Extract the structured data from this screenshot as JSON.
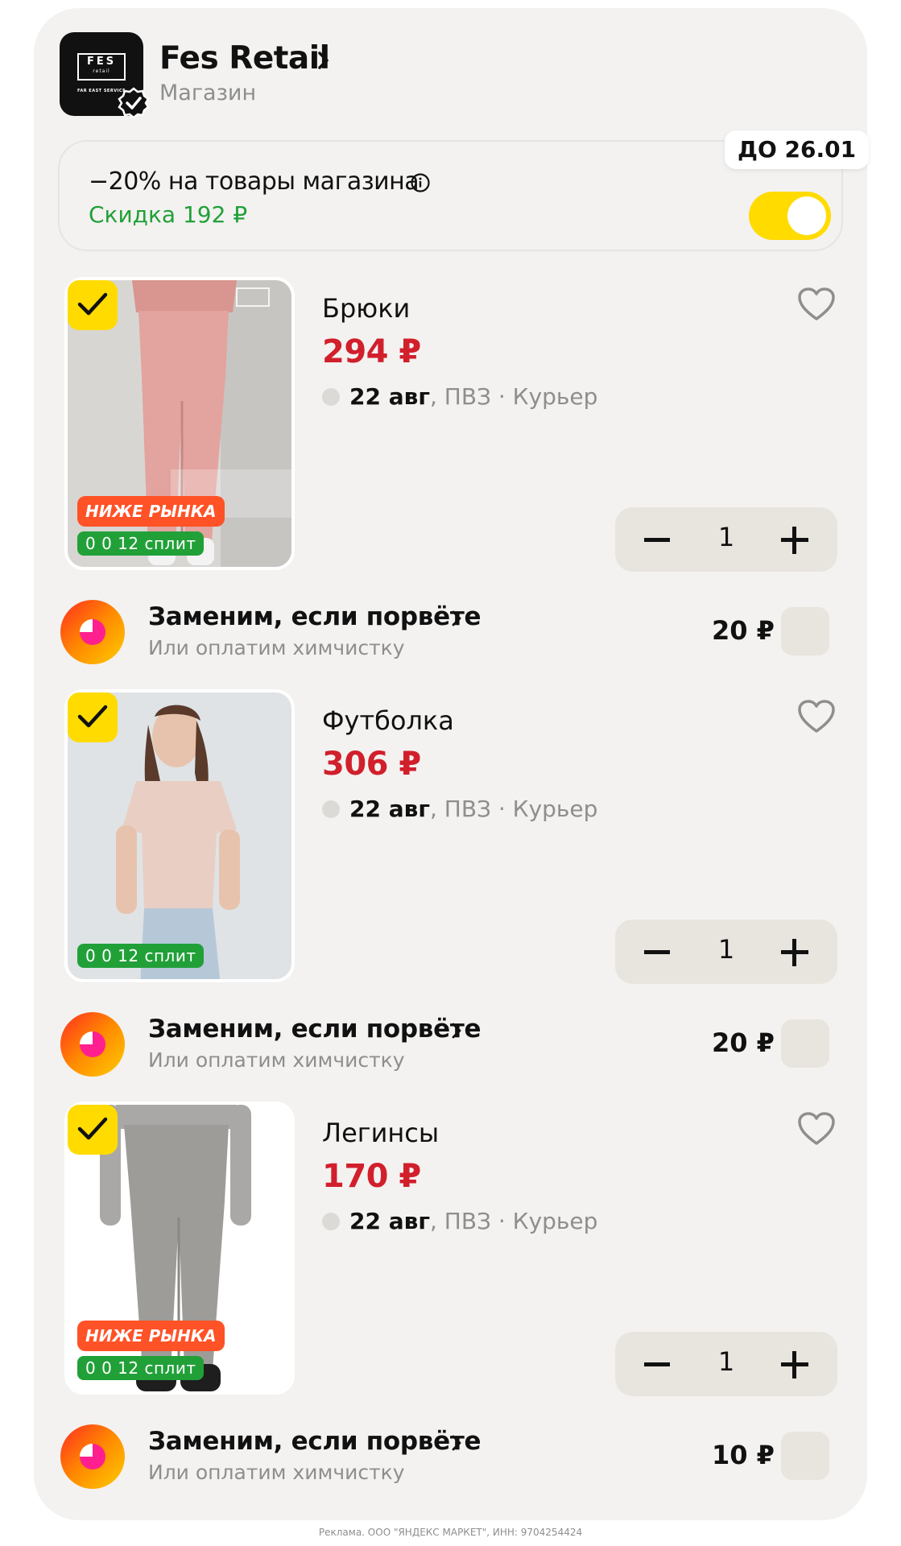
{
  "store": {
    "name": "Fes Retail",
    "type": "Магазин",
    "logo_text": "FES",
    "logo_small": "retail",
    "logo_sub": "FAR EAST SERVICE"
  },
  "promo": {
    "title": "−20% на товары магазина",
    "discount": "Скидка 192 ₽",
    "valid_until": "ДО 26.01",
    "enabled": true
  },
  "items": [
    {
      "title": "Брюки",
      "price": "294 ₽",
      "delivery_date": "22 авг",
      "delivery_methods": ", ПВЗ · Курьер",
      "badge_market": "НИЖЕ РЫНКА",
      "badge_split": "0 0 12 сплит",
      "quantity": "1",
      "selected": true,
      "insurance": {
        "title": "Заменим, если порвёте",
        "subtitle": "Или оплатим химчистку",
        "price": "20 ₽"
      }
    },
    {
      "title": "Футболка",
      "price": "306 ₽",
      "delivery_date": "22 авг",
      "delivery_methods": ", ПВЗ · Курьер",
      "badge_split": "0 0 12 сплит",
      "quantity": "1",
      "selected": true,
      "insurance": {
        "title": "Заменим, если порвёте",
        "subtitle": "Или оплатим химчистку",
        "price": "20 ₽"
      }
    },
    {
      "title": "Легинсы",
      "price": "170 ₽",
      "delivery_date": "22 авг",
      "delivery_methods": ", ПВЗ · Курьер",
      "badge_market": "НИЖЕ РЫНКА",
      "badge_split": "0 0 12 сплит",
      "quantity": "1",
      "selected": true,
      "insurance": {
        "title": "Заменим, если порвёте",
        "subtitle": "Или оплатим химчистку",
        "price": "10 ₽"
      }
    }
  ],
  "footer": {
    "ad_text": "Реклама. ООО \"ЯНДЕКС МАРКЕТ\", ИНН: 9704254424"
  },
  "colors": {
    "accent": "#ffdb00",
    "price": "#d11f2c",
    "green": "#21a038",
    "badge_orange": "#ff5226"
  }
}
